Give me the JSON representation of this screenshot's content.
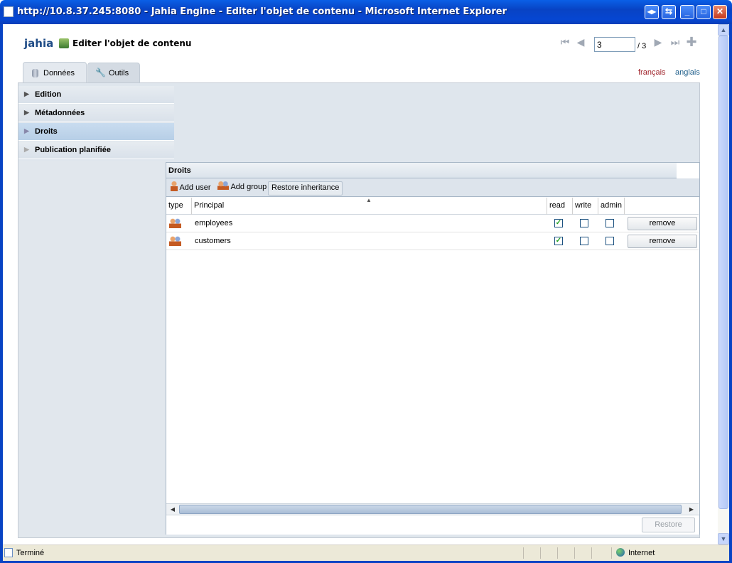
{
  "window": {
    "title": "http://10.8.37.245:8080 - Jahia Engine - Editer l'objet de contenu - Microsoft Internet Explorer"
  },
  "header": {
    "logo": "jahia",
    "page_title": "Editer l'objet de contenu",
    "page_number": "3",
    "page_total": "/ 3"
  },
  "tabs": [
    {
      "label": "Données",
      "active": true
    },
    {
      "label": "Outils",
      "active": false
    }
  ],
  "languages": [
    {
      "label": "français",
      "color": "#a0242b"
    },
    {
      "label": "anglais",
      "color": "#1f5f8b"
    }
  ],
  "accordion": [
    {
      "label": "Edition",
      "selected": false
    },
    {
      "label": "Métadonnées",
      "selected": false
    },
    {
      "label": "Droits",
      "selected": true
    },
    {
      "label": "Publication planifiée",
      "selected": false
    }
  ],
  "rights": {
    "title": "Droits",
    "toolbar": {
      "add_user": "Add user",
      "add_group": "Add group",
      "restore_inheritance": "Restore inheritance"
    },
    "columns": [
      "type",
      "Principal",
      "read",
      "write",
      "admin",
      ""
    ],
    "rows": [
      {
        "principal": "employees",
        "read": true,
        "write": false,
        "admin": false,
        "action": "remove"
      },
      {
        "principal": "customers",
        "read": true,
        "write": false,
        "admin": false,
        "action": "remove"
      }
    ],
    "footer_button": "Restore"
  },
  "statusbar": {
    "left": "Terminé",
    "zone": "Internet"
  }
}
